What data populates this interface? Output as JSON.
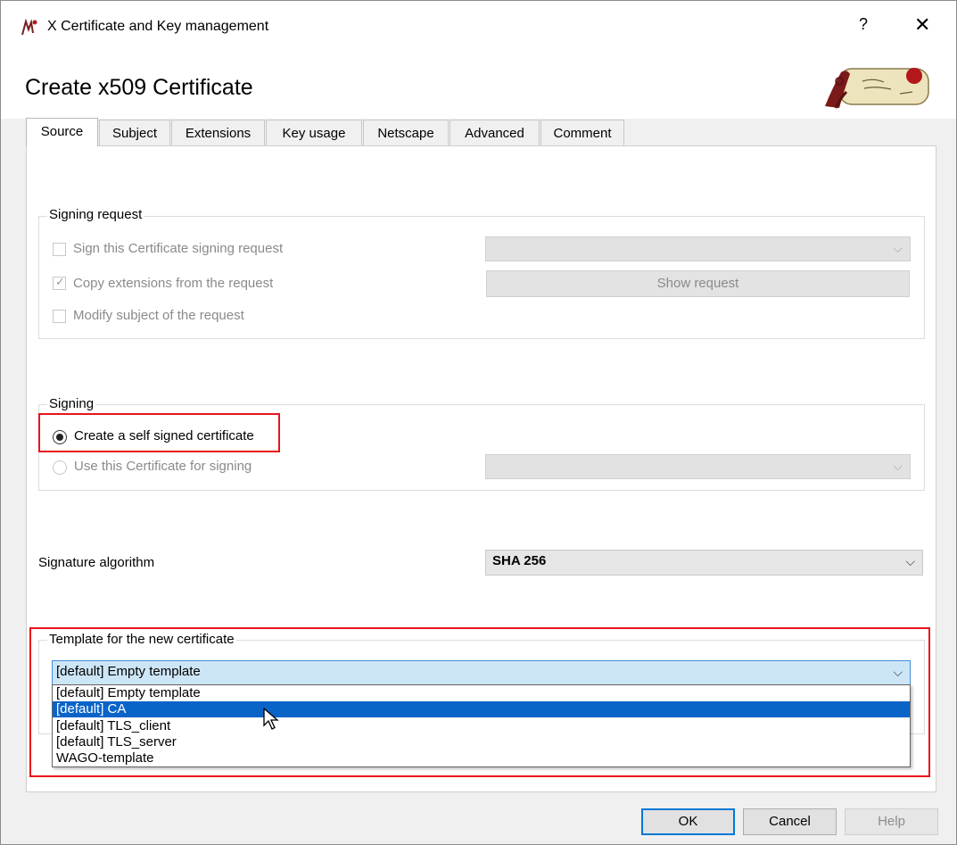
{
  "window": {
    "title": "X Certificate and Key management",
    "help_label": "?",
    "close_label": "✕"
  },
  "dialog": {
    "title": "Create x509 Certificate"
  },
  "tabs": [
    {
      "label": "Source",
      "active": true
    },
    {
      "label": "Subject"
    },
    {
      "label": "Extensions"
    },
    {
      "label": "Key usage"
    },
    {
      "label": "Netscape"
    },
    {
      "label": "Advanced"
    },
    {
      "label": "Comment"
    }
  ],
  "signing_request": {
    "group_label": "Signing request",
    "sign_csr_label": "Sign this Certificate signing request",
    "sign_csr_checked": false,
    "copy_ext_label": "Copy extensions from the request",
    "copy_ext_checked": true,
    "modify_subject_label": "Modify subject of the request",
    "modify_subject_checked": false,
    "request_select_value": "",
    "show_request_label": "Show request"
  },
  "signing": {
    "group_label": "Signing",
    "self_signed_label": "Create a self signed certificate",
    "self_signed_selected": true,
    "use_cert_label": "Use this Certificate for signing",
    "cert_select_value": ""
  },
  "signature_algorithm": {
    "label": "Signature algorithm",
    "value": "SHA 256"
  },
  "template": {
    "group_label": "Template for the new certificate",
    "selected": "[default] Empty template",
    "options": [
      "[default] Empty template",
      "[default] CA",
      "[default] TLS_client",
      "[default] TLS_server",
      "WAGO-template"
    ],
    "highlighted_index": 1
  },
  "buttons": {
    "ok": "OK",
    "cancel": "Cancel",
    "help": "Help"
  },
  "colors": {
    "highlight_red": "#e8131c",
    "selection_blue": "#0a64c8",
    "focus_blue": "#0078d7"
  },
  "icons": {
    "app": "xca-app-icon",
    "logo": "certificate-scroll-logo",
    "cursor": "mouse-pointer-icon"
  }
}
